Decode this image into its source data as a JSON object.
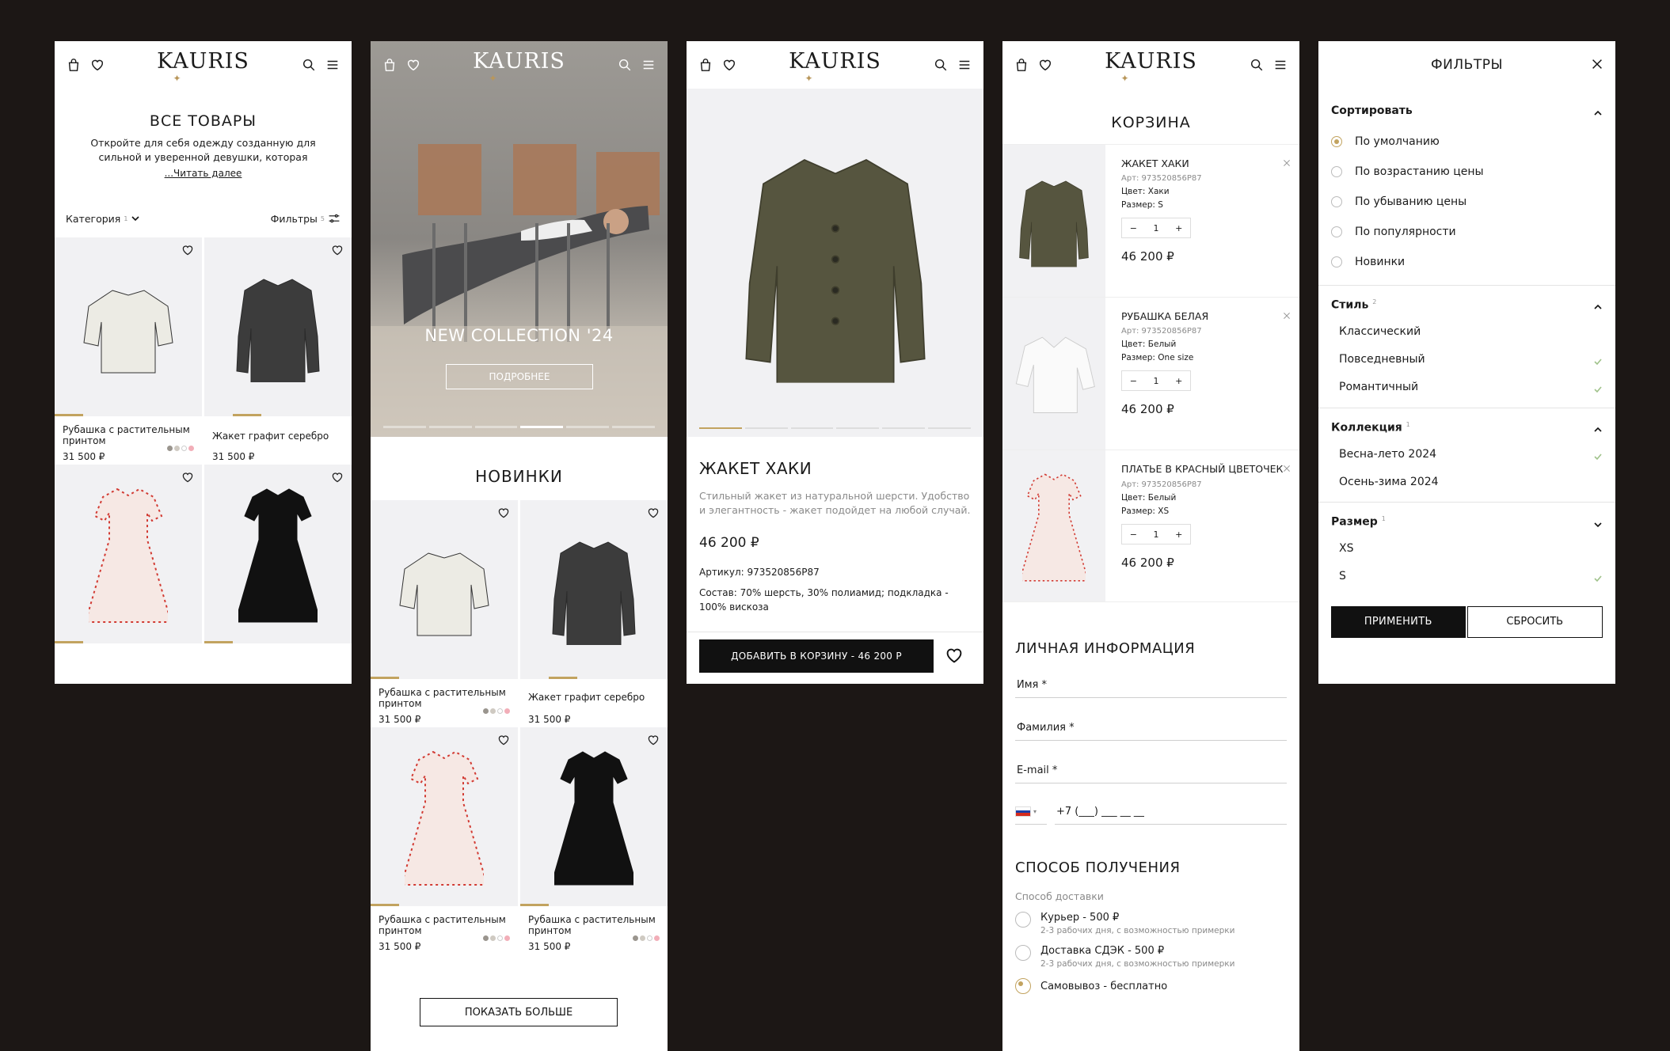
{
  "brand": "KAURIS",
  "catalog": {
    "title": "ВСЕ ТОВАРЫ",
    "description": "Откройте для себя одежду созданную для сильной и уверенной девушки, которая",
    "read_more": "...Читать далее",
    "category_label": "Категория",
    "category_count": "1",
    "filters_label": "Фильтры",
    "filters_count": "5",
    "products": [
      {
        "name": "Рубашка с растительным принтом",
        "price": "31 500 ₽"
      },
      {
        "name": "Жакет графит серебро",
        "price": "31 500 ₽"
      },
      {
        "name": "",
        "price": ""
      },
      {
        "name": "",
        "price": ""
      }
    ]
  },
  "home": {
    "hero_title": "NEW COLLECTION '24",
    "hero_button": "ПОДРОБНЕЕ",
    "section_title": "НОВИНКИ",
    "products": [
      {
        "name": "Рубашка с растительным принтом",
        "price": "31 500 ₽"
      },
      {
        "name": "Жакет графит серебро",
        "price": "31 500 ₽"
      },
      {
        "name": "Рубашка с растительным принтом",
        "price": "31 500 ₽"
      },
      {
        "name": "Рубашка с растительным принтом",
        "price": "31 500 ₽"
      }
    ],
    "show_more": "ПОКАЗАТЬ БОЛЬШЕ"
  },
  "product": {
    "title": "ЖАКЕТ ХАКИ",
    "description": "Стильный жакет из натуральной шерсти. Удобство и элегантность - жакет подойдет на любой случай.",
    "price": "46 200 ₽",
    "sku": "Артикул: 973520856P87",
    "composition": "Состав: 70% шерсть, 30% полиамид; подкладка - 100% вискоза",
    "add_to_cart": "ДОБАВИТЬ В КОРЗИНУ - 46 200 Р"
  },
  "cart": {
    "title": "КОРЗИНА",
    "items": [
      {
        "name": "ЖАКЕТ ХАКИ",
        "sku": "Арт: 973520856P87",
        "color": "Цвет: Хаки",
        "size": "Размер: S",
        "qty": "1",
        "price": "46 200 ₽"
      },
      {
        "name": "РУБАШКА БЕЛАЯ",
        "sku": "Арт: 973520856P87",
        "color": "Цвет: Белый",
        "size": "Размер: One size",
        "qty": "1",
        "price": "46 200 ₽"
      },
      {
        "name": "ПЛАТЬЕ В КРАСНЫЙ ЦВЕТОЧЕК",
        "sku": "Арт: 973520856P87",
        "color": "Цвет: Белый",
        "size": "Размер: XS",
        "qty": "1",
        "price": "46 200 ₽"
      }
    ],
    "personal_title": "ЛИЧНАЯ ИНФОРМАЦИЯ",
    "fields": {
      "name": "Имя *",
      "surname": "Фамилия *",
      "email": "E-mail *",
      "phone": "+7 (___) ___ __ __"
    },
    "delivery_title": "СПОСОБ ПОЛУЧЕНИЯ",
    "delivery_label": "Способ доставки",
    "delivery_options": [
      {
        "label": "Курьер - 500 ₽",
        "sub": "2-3 рабочих дня, с возможностью примерки"
      },
      {
        "label": "Доставка СДЭК - 500 ₽",
        "sub": "2-3 рабочих дня, с возможностью примерки"
      },
      {
        "label": "Самовывоз - бесплатно",
        "sub": ""
      }
    ]
  },
  "filters": {
    "title": "ФИЛЬТРЫ",
    "sort": {
      "label": "Сортировать",
      "options": [
        "По умолчанию",
        "По возрастанию цены",
        "По убыванию цены",
        "По популярности",
        "Новинки"
      ]
    },
    "style": {
      "label": "Стиль",
      "count": "2",
      "options": [
        "Классический",
        "Повседневный",
        "Романтичный"
      ]
    },
    "collection": {
      "label": "Коллекция",
      "count": "1",
      "options": [
        "Весна-лето 2024",
        "Осень-зима 2024"
      ]
    },
    "size": {
      "label": "Размер",
      "count": "1",
      "options": [
        "XS",
        "S"
      ]
    },
    "apply": "ПРИМЕНИТЬ",
    "reset": "СБРОСИТЬ"
  },
  "colors": {
    "accent": "#c2a35f",
    "dark": "#111111",
    "background": "#1c1715",
    "khaki": "#56553f",
    "graphite": "#3c3c3c",
    "floral_red": "#d23b33"
  }
}
